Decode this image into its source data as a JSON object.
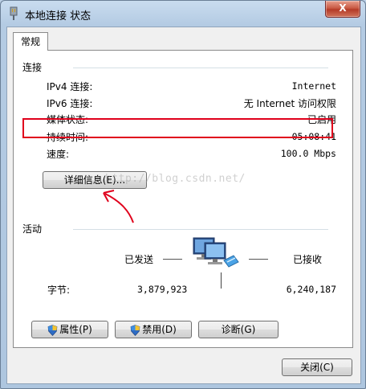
{
  "window": {
    "title": "本地连接 状态",
    "close_glyph": "X"
  },
  "tab": {
    "label": "常规"
  },
  "connection": {
    "title": "连接",
    "rows": [
      {
        "label": "IPv4 连接:",
        "value": "Internet"
      },
      {
        "label": "IPv6 连接:",
        "value": "无 Internet 访问权限"
      },
      {
        "label": "媒体状态:",
        "value": "已启用"
      },
      {
        "label": "持续时间:",
        "value": "05:08:41"
      },
      {
        "label": "速度:",
        "value": "100.0 Mbps"
      }
    ],
    "details_button": "详细信息(E)..."
  },
  "watermark": "http://blog.csdn.net/",
  "activity": {
    "title": "活动",
    "sent_label": "已发送",
    "received_label": "已接收",
    "bytes_label": "字节:",
    "bytes_sent": "3,879,923",
    "bytes_received": "6,240,187"
  },
  "buttons": {
    "properties": "属性(P)",
    "disable": "禁用(D)",
    "diagnose": "诊断(G)",
    "close": "关闭(C)"
  },
  "colors": {
    "highlight": "#e0001c",
    "annotation_arrow": "#e0001c"
  },
  "icons": [
    "network-adapter-icon",
    "network-computers-icon",
    "uac-shield-icon",
    "close-icon"
  ]
}
